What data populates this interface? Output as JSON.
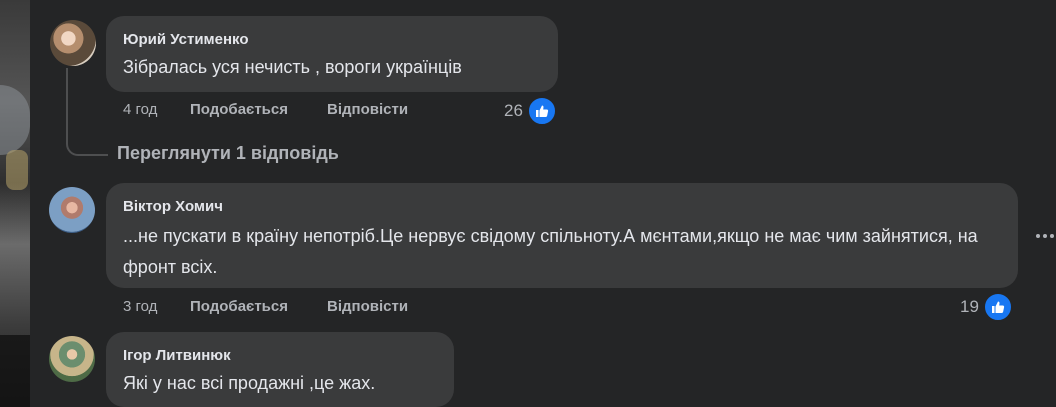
{
  "comments": [
    {
      "author": "Юрий Устименко",
      "text": "Зібралась уся нечисть , вороги українців",
      "time": "4 год",
      "like_label": "Подобається",
      "reply_label": "Відповісти",
      "reaction_count": "26"
    },
    {
      "author": "Віктор Хомич",
      "text": "...не пускати в країну непотріб.Це нервує свідому спільноту.А мєнтами,якщо не має чим зайнятися, на фронт всіх.",
      "time": "3 год",
      "like_label": "Подобається",
      "reply_label": "Відповісти",
      "reaction_count": "19"
    },
    {
      "author": "Ігор Литвинюк",
      "text": "Які у нас всі продажні ,це жах."
    }
  ],
  "view_replies_label": "Переглянути 1 відповідь",
  "colors": {
    "background": "#242526",
    "bubble": "#3a3b3c",
    "primary_text": "#e4e6eb",
    "secondary_text": "#b0b3b8",
    "like_blue": "#1877f2"
  },
  "icons": [
    "like-thumb-icon",
    "more-options-icon"
  ]
}
